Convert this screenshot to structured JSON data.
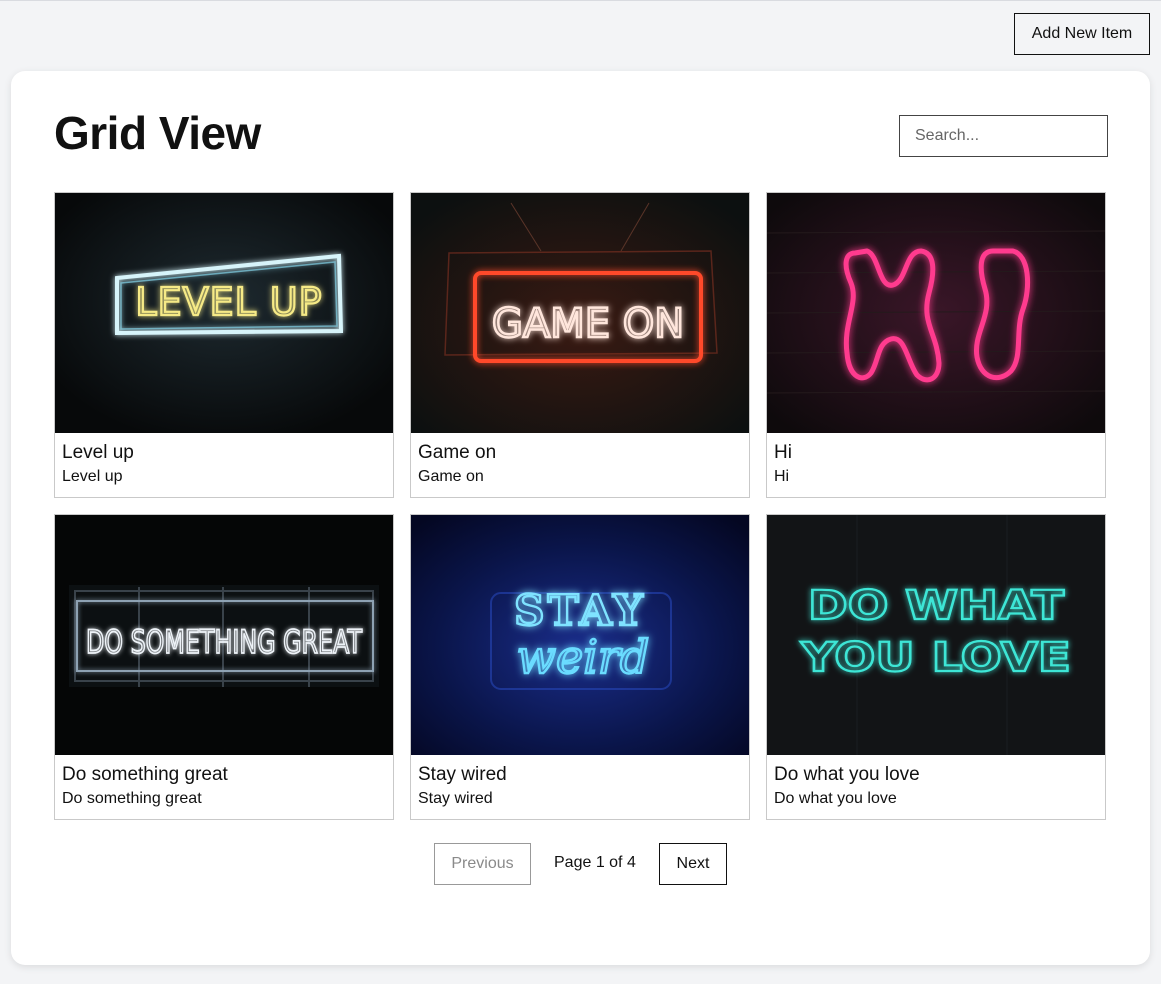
{
  "header": {
    "add_button_label": "Add New Item"
  },
  "main": {
    "title": "Grid View",
    "search": {
      "placeholder": "Search...",
      "value": ""
    }
  },
  "items": [
    {
      "title": "Level up",
      "subtitle": "Level up",
      "image_icon": "neon-level-up-image",
      "sign_text": "LEVEL UP",
      "neon_color": "#f3e47a",
      "frame_color": "#bfe9f2"
    },
    {
      "title": "Game on",
      "subtitle": "Game on",
      "image_icon": "neon-game-on-image",
      "sign_text": "GAME ON",
      "neon_color": "#ffe6dc",
      "frame_color": "#ff4a2a"
    },
    {
      "title": "Hi",
      "subtitle": "Hi",
      "image_icon": "neon-hi-image",
      "sign_text": "HI",
      "neon_color": "#ff2f86",
      "frame_color": "#ff2f86"
    },
    {
      "title": "Do something great",
      "subtitle": "Do something great",
      "image_icon": "neon-do-something-great-image",
      "sign_text": "DO SOMETHING GREAT",
      "neon_color": "#e8eef5",
      "frame_color": "#9fb2c4"
    },
    {
      "title": "Stay wired",
      "subtitle": "Stay wired",
      "image_icon": "neon-stay-weird-image",
      "sign_text": "STAY weird",
      "neon_color": "#5fd4ff",
      "frame_color": "#1f5bff"
    },
    {
      "title": "Do what you love",
      "subtitle": "Do what you love",
      "image_icon": "neon-do-what-you-love-image",
      "sign_text": "DO WHAT YOU LOVE",
      "neon_color": "#38e0d0",
      "frame_color": "#38e0d0"
    }
  ],
  "pagination": {
    "previous_label": "Previous",
    "page_info": "Page 1 of 4",
    "next_label": "Next",
    "current_page": 1,
    "total_pages": 4
  },
  "colors": {
    "page_background": "#f3f4f6",
    "panel_background": "#ffffff",
    "text": "#111111",
    "border": "#c9c9c9",
    "disabled_text": "#8a8a8a"
  }
}
